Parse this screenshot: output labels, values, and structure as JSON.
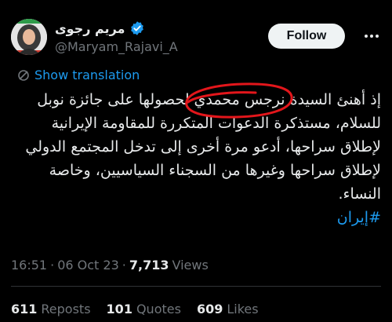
{
  "author": {
    "display_name": "مریم رجوی",
    "handle": "@Maryam_Rajavi_A",
    "verified": true
  },
  "follow_button": {
    "label": "Follow"
  },
  "translation": {
    "label": "Show translation"
  },
  "tweet": {
    "text": "إذ أهنئ السيدة نرجس محمدي لحصولها على جائزة نوبل للسلام، مستذكرة الدعوات المتكررة للمقاومة الإيرانية لإطلاق سراحها، أدعو مرة أخرى إلى تدخل المجتمع الدولي لإطلاق سراحها وغيرها من السجناء السياسيين، وخاصة النساء.",
    "hashtag": "#إيران"
  },
  "meta": {
    "time": "16:51",
    "sep1": "·",
    "date": "06 Oct 23",
    "sep2": "·",
    "views_count": "7,713",
    "views_label": "Views"
  },
  "stats": {
    "reposts_count": "611",
    "reposts_label": "Reposts",
    "quotes_count": "101",
    "quotes_label": "Quotes",
    "likes_count": "609",
    "likes_label": "Likes"
  },
  "colors": {
    "background": "#000000",
    "accent": "#1d9bf0",
    "text": "#e7e9ea",
    "muted": "#71767b",
    "annotation": "#e3161b"
  }
}
